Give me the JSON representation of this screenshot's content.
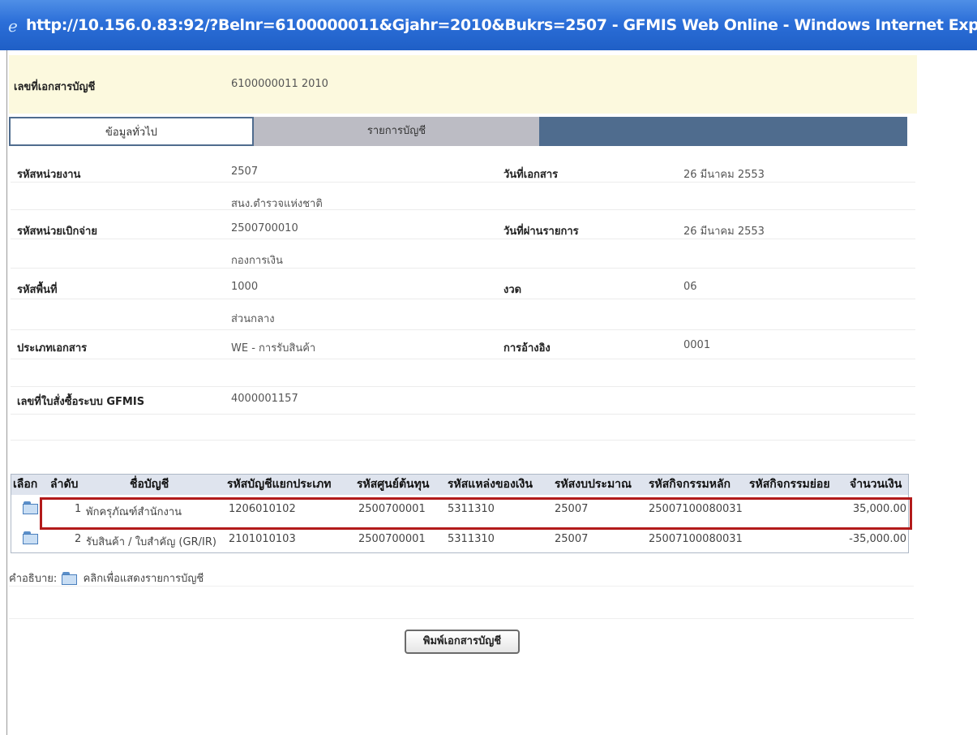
{
  "window": {
    "title": "http://10.156.0.83:92/?Belnr=6100000011&Gjahr=2010&Bukrs=2507 - GFMIS Web Online - Windows Internet Explorer"
  },
  "doc_header": {
    "label": "เลขที่เอกสารบัญชี",
    "value": "6100000011  2010"
  },
  "tabs": [
    {
      "label": "ข้อมูลทั่วไป",
      "active": true
    },
    {
      "label": "รายการบัญชี",
      "active": false
    }
  ],
  "info": {
    "unit_code": {
      "label": "รหัสหน่วยงาน",
      "value": "2507",
      "sub": "สนง.ตำรวจแห่งชาติ"
    },
    "disburse_code": {
      "label": "รหัสหน่วยเบิกจ่าย",
      "value": "2500700010",
      "sub": "กองการเงิน"
    },
    "area_code": {
      "label": "รหัสพื้นที่",
      "value": "1000",
      "sub": "ส่วนกลาง"
    },
    "doc_type": {
      "label": "ประเภทเอกสาร",
      "value": "WE - การรับสินค้า"
    },
    "po_number": {
      "label": "เลขที่ใบสั่งซื้อระบบ GFMIS",
      "value": "4000001157"
    },
    "doc_date": {
      "label": "วันที่เอกสาร",
      "value": "26 มีนาคม 2553"
    },
    "posting_date": {
      "label": "วันที่ผ่านรายการ",
      "value": "26 มีนาคม 2553"
    },
    "period": {
      "label": "งวด",
      "value": "06"
    },
    "reference": {
      "label": "การอ้างอิง",
      "value": "0001"
    }
  },
  "grid": {
    "headers": [
      "เลือก",
      "ลำดับ",
      "ชื่อบัญชี",
      "รหัสบัญชีแยกประเภท",
      "รหัสศูนย์ต้นทุน",
      "รหัสแหล่งของเงิน",
      "รหัสงบประมาณ",
      "รหัสกิจกรรมหลัก",
      "รหัสกิจกรรมย่อย",
      "จำนวนเงิน"
    ],
    "rows": [
      {
        "seq": "1",
        "name": "พักครุภัณฑ์สำนักงาน",
        "gl": "1206010102",
        "cost_center": "2500700001",
        "fund": "5311310",
        "budget": "25007",
        "main_activity": "25007100080031",
        "sub_activity": "",
        "amount": "35,000.00",
        "highlighted": true
      },
      {
        "seq": "2",
        "name": "รับสินค้า / ใบสำคัญ (GR/IR)",
        "gl": "2101010103",
        "cost_center": "2500700001",
        "fund": "5311310",
        "budget": "25007",
        "main_activity": "25007100080031",
        "sub_activity": "",
        "amount": "-35,000.00",
        "highlighted": false
      }
    ]
  },
  "legend": {
    "prefix": "คำอธิบาย:",
    "text": "คลิกเพื่อแสดงรายการบัญชี",
    "icon": "folder-icon"
  },
  "print_button": {
    "label": "พิมพ์เอกสารบัญชี"
  },
  "colors": {
    "title_bar": "#2b6ed8",
    "header_bg": "#fcf9de",
    "tab_bar": "#4f6c8e",
    "highlight": "#b31b1b"
  }
}
